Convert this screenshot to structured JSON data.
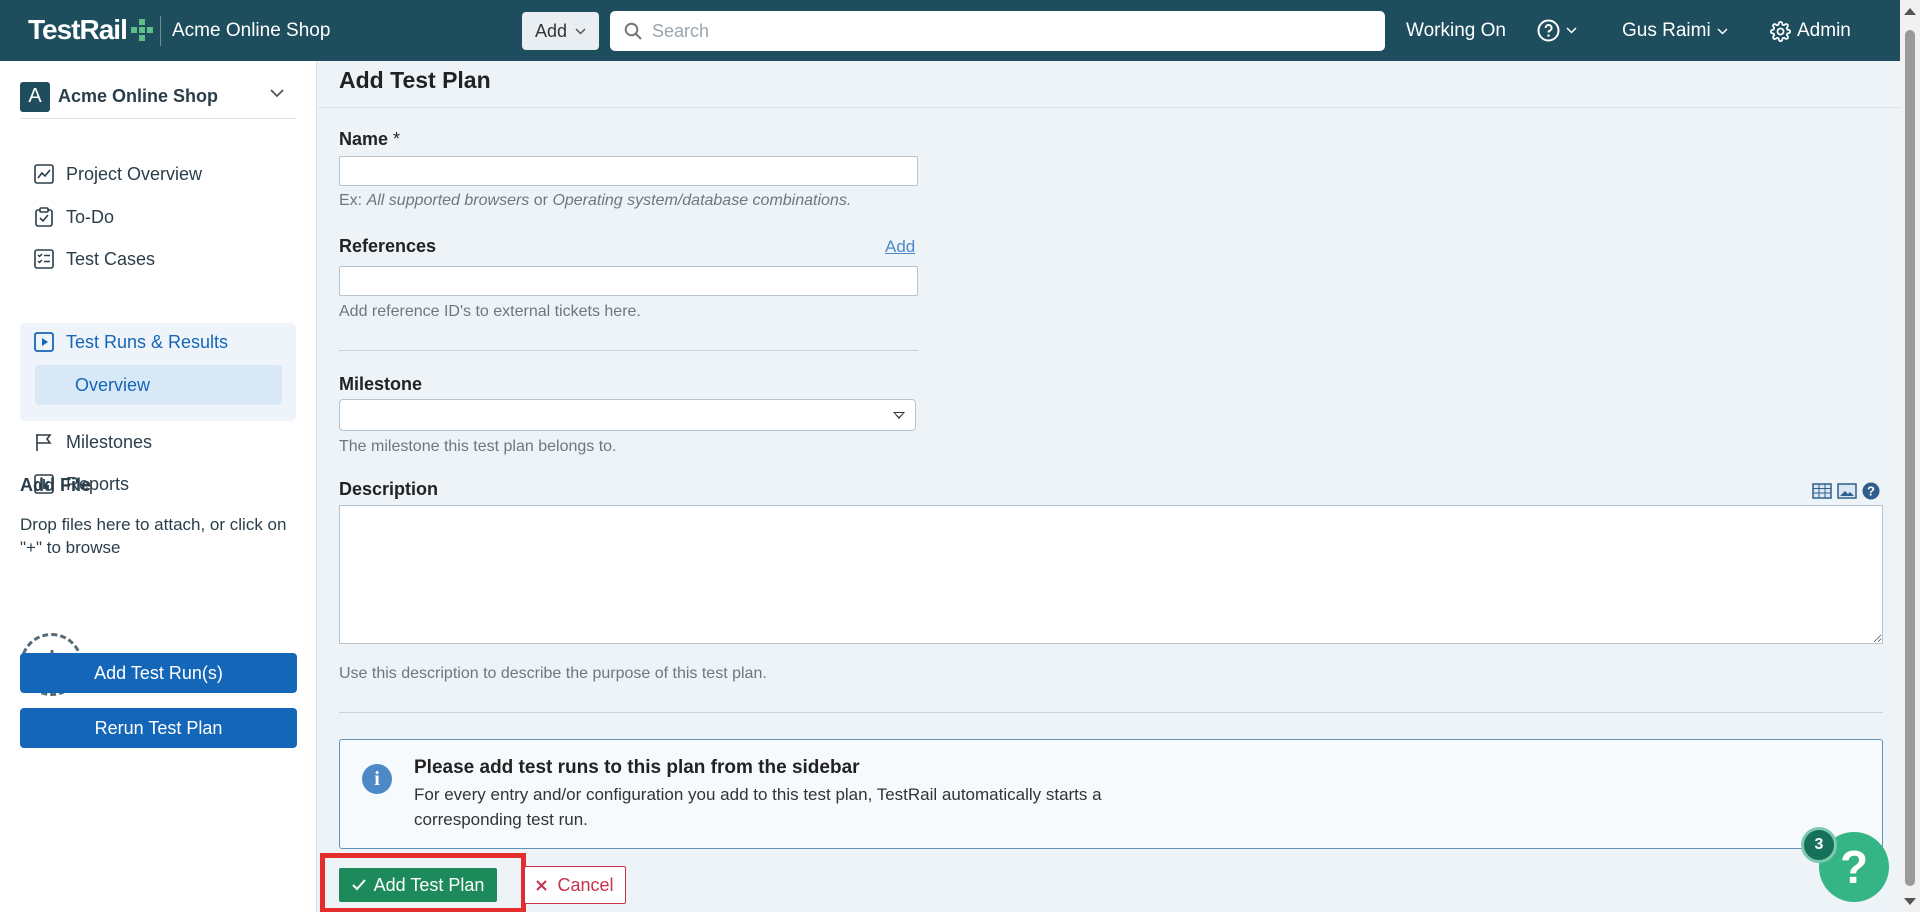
{
  "topbar": {
    "logo": "TestRail",
    "project": "Acme Online Shop",
    "add_label": "Add",
    "search_placeholder": "Search",
    "working_on": "Working On",
    "user": "Gus Raimi",
    "admin": "Admin"
  },
  "sidebar": {
    "project_badge": "A",
    "project_name": "Acme Online Shop",
    "items": [
      {
        "label": "Project Overview",
        "icon": "chart-icon"
      },
      {
        "label": "To-Do",
        "icon": "clipboard-check-icon"
      },
      {
        "label": "Test Cases",
        "icon": "checklist-icon"
      },
      {
        "label": "Test Runs & Results",
        "icon": "play-square-icon"
      },
      {
        "label": "Milestones",
        "icon": "flag-icon"
      },
      {
        "label": "Reports",
        "icon": "bar-chart-icon"
      }
    ],
    "sub_item": "Overview",
    "add_file_title": "Add File",
    "add_file_text": "Drop files here to attach, or click on \"+\" to browse",
    "buttons": [
      "Add Test Run(s)",
      "Rerun Test Plan"
    ]
  },
  "form": {
    "title": "Add Test Plan",
    "name_label": "Name",
    "required_mark": "*",
    "name_value": "",
    "name_hint_prefix": "Ex: ",
    "name_hint_a": "All supported browsers",
    "name_hint_or": " or ",
    "name_hint_b": "Operating system/database combinations.",
    "references_label": "References",
    "references_add": "Add",
    "references_value": "",
    "references_hint": "Add reference ID's to external tickets here.",
    "milestone_label": "Milestone",
    "milestone_value": "",
    "milestone_hint": "The milestone this test plan belongs to.",
    "description_label": "Description",
    "description_value": "",
    "description_hint": "Use this description to describe the purpose of this test plan.",
    "info_title": "Please add test runs to this plan from the sidebar",
    "info_text": "For every entry and/or configuration you add to this test plan, TestRail automatically starts a corresponding test run.",
    "submit_label": "Add Test Plan",
    "cancel_label": "Cancel"
  },
  "help": {
    "badge_count": "3",
    "symbol": "?"
  },
  "colors": {
    "topbar": "#1e4d5e",
    "primary": "#1466b8",
    "submit": "#1d8a5c",
    "cancel": "#c7314e",
    "highlight": "#e52d2d",
    "help": "#35b585"
  }
}
